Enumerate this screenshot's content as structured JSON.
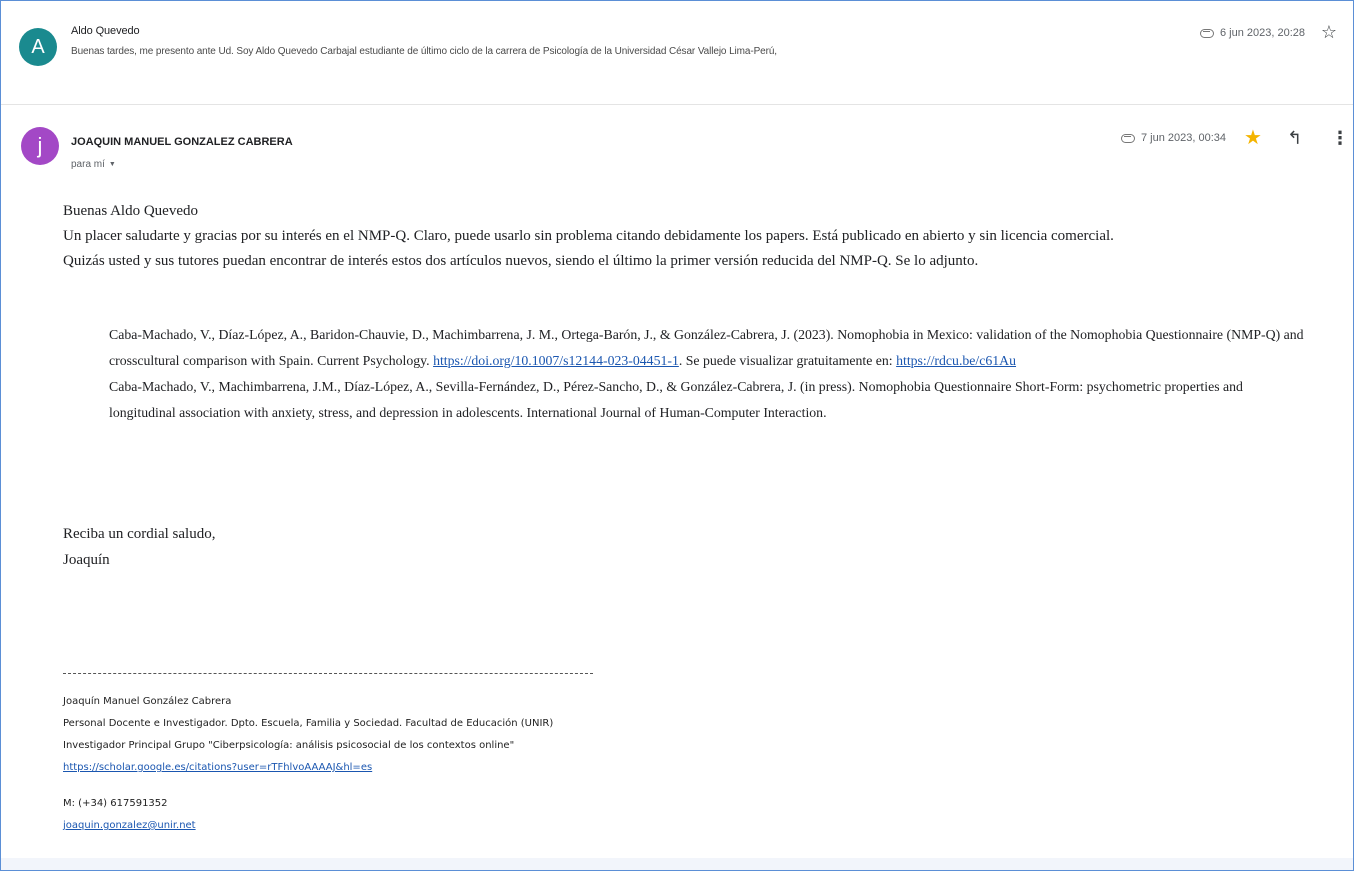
{
  "thread": {
    "collapsed": {
      "avatar_letter": "A",
      "avatar_color": "#1a8a8f",
      "sender": "Aldo Quevedo",
      "snippet": "Buenas tardes, me presento ante Ud. Soy Aldo Quevedo Carbajal estudiante de último ciclo de la carrera de Psicología de la Universidad César Vallejo Lima-Perú,",
      "date": "6 jun 2023, 20:28",
      "icons": {
        "attachment": "attachment-icon",
        "star": "star-outline-icon"
      }
    },
    "open": {
      "avatar_letter": "j",
      "avatar_color": "#a348c6",
      "sender": "JOAQUIN MANUEL GONZALEZ CABRERA",
      "recipient": "para mí",
      "recipient_caret": "▼",
      "date": "7 jun 2023, 00:34",
      "star_color": "#f4b400",
      "icons": {
        "attachment": "attachment-icon",
        "star": "star-filled-icon",
        "reply": "reply-icon",
        "more": "more-vertical-icon"
      },
      "reply_glyph": "↰",
      "more_glyph": "⋮",
      "star_glyph": "★",
      "star_outline_glyph": "☆",
      "body": {
        "greeting": "Buenas Aldo Quevedo",
        "paragraph_1": "Un placer saludarte y gracias por su interés en el NMP-Q. Claro, puede usarlo sin problema citando debidamente los papers. Está publicado en abierto y sin licencia comercial.",
        "paragraph_2": "Quizás usted y sus tutores puedan encontrar de interés estos dos artículos nuevos, siendo el último la primer versión reducida del NMP-Q. Se lo adjunto.",
        "ref_1_text": "Caba-Machado, V., Díaz-López, A., Baridon-Chauvie, D., Machimbarrena, J. M., Ortega-Barón, J., & González-Cabrera, J. (2023). Nomophobia in Mexico: validation of the Nomophobia Questionnaire (NMP-Q) and crosscultural comparison with Spain. Current Psychology. ",
        "ref_1_doi": "https://doi.org/10.1007/s12144-023-04451-1",
        "ref_1_tail": ". Se puede visualizar gratuitamente en: ",
        "ref_1_link": "https://rdcu.be/c61Au",
        "ref_2_text": "Caba-Machado, V., Machimbarrena, J.M., Díaz-López, A., Sevilla-Fernández, D., Pérez-Sancho, D., & González-Cabrera, J. (in press). Nomophobia Questionnaire Short-Form: psychometric properties and longitudinal association with anxiety, stress, and depression in adolescents. International Journal of Human-Computer Interaction.",
        "closing_1": "Reciba un cordial saludo,",
        "closing_2": "Joaquín"
      },
      "signature": {
        "name": "Joaquín Manuel González Cabrera",
        "role": "Personal Docente e Investigador.  Dpto. Escuela, Familia y Sociedad. Facultad de Educación (UNIR)",
        "group": "Investigador Principal Grupo \"Ciberpsicología: análisis psicosocial de los contextos online\"",
        "scholar_link": "https://scholar.google.es/citations?user=rTFhlvoAAAAJ&hl=es",
        "phone": "M: (+34) 617591352",
        "email": "joaquin.gonzalez@unir.net"
      }
    }
  },
  "colors": {
    "link": "#1a56b0",
    "frame_border": "#5b8fd6"
  }
}
